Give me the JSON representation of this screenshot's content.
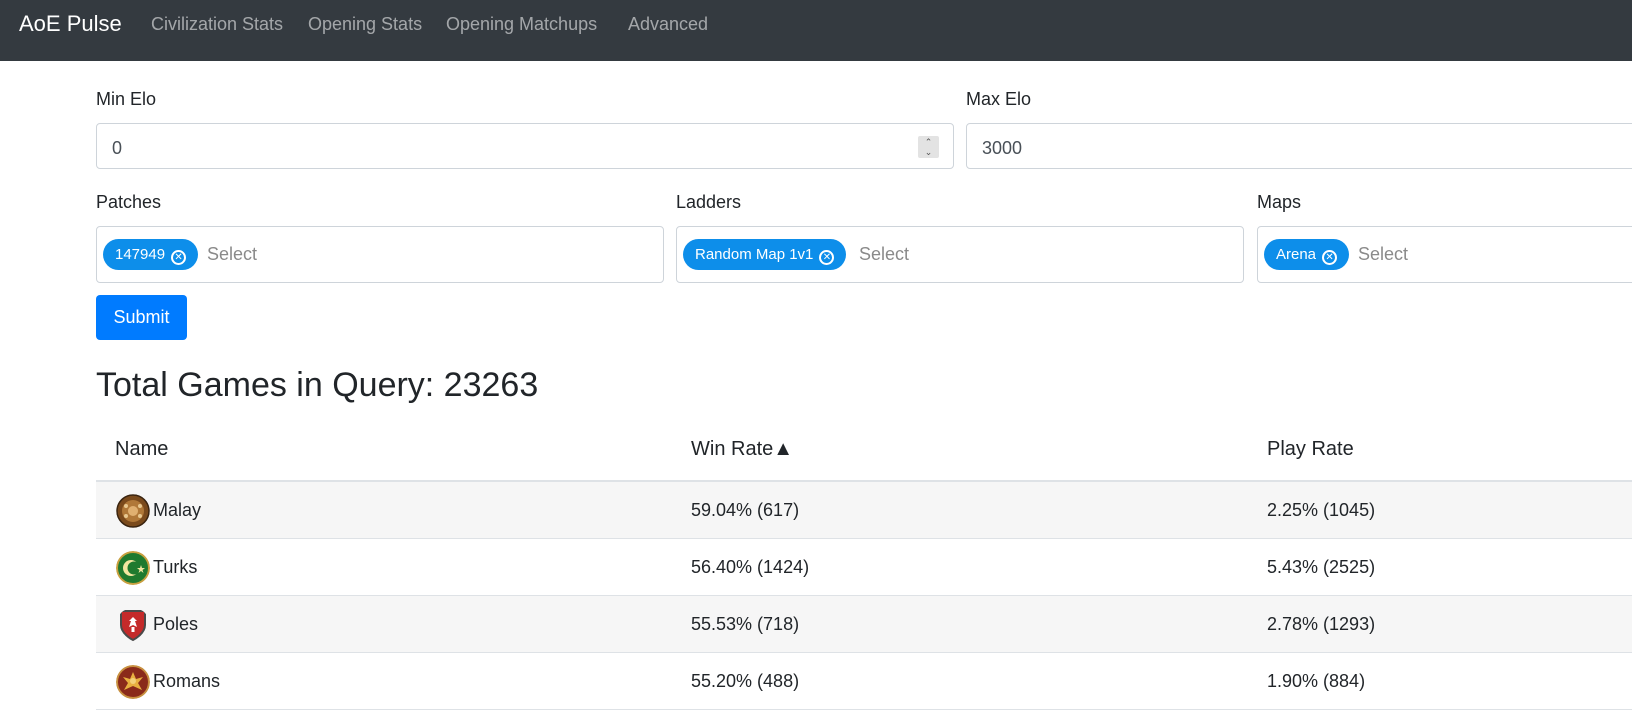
{
  "navbar": {
    "brand": "AoE Pulse",
    "links": [
      "Civilization Stats",
      "Opening Stats",
      "Opening Matchups",
      "Advanced"
    ]
  },
  "form": {
    "min_elo": {
      "label": "Min Elo",
      "value": "0"
    },
    "max_elo": {
      "label": "Max Elo",
      "value": "3000"
    },
    "patches": {
      "label": "Patches",
      "chip": "147949",
      "placeholder": "Select"
    },
    "ladders": {
      "label": "Ladders",
      "chip": "Random Map 1v1",
      "placeholder": "Select"
    },
    "maps": {
      "label": "Maps",
      "chip": "Arena",
      "placeholder": "Select"
    },
    "submit_label": "Submit"
  },
  "total_games": "Total Games in Query: 23263",
  "table": {
    "headers": {
      "name": "Name",
      "win_rate": "Win Rate",
      "sort_indicator": "▲",
      "play_rate": "Play Rate"
    },
    "rows": [
      {
        "name": "Malay",
        "win_rate": "59.04% (617)",
        "play_rate": "2.25% (1045)",
        "icon": "malay-emblem-icon"
      },
      {
        "name": "Turks",
        "win_rate": "56.40% (1424)",
        "play_rate": "5.43% (2525)",
        "icon": "turks-emblem-icon"
      },
      {
        "name": "Poles",
        "win_rate": "55.53% (718)",
        "play_rate": "2.78% (1293)",
        "icon": "poles-emblem-icon"
      },
      {
        "name": "Romans",
        "win_rate": "55.20% (488)",
        "play_rate": "1.90% (884)",
        "icon": "romans-emblem-icon"
      }
    ]
  },
  "colors": {
    "navbar_bg": "#343a40",
    "chip_bg": "#0d8eea",
    "primary_button": "#007bff"
  }
}
